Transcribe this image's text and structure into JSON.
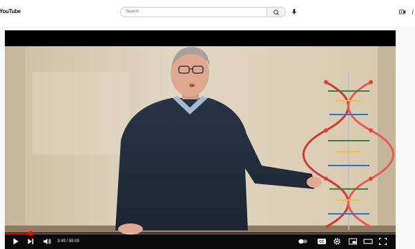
{
  "header": {
    "logo_text": "YouTube",
    "search_placeholder": "Search"
  },
  "player": {
    "current_time": "3:49",
    "separator": " / ",
    "duration": "59:09",
    "progress": 0.0645
  },
  "icons": {
    "search": "search-icon",
    "mic": "microphone-icon",
    "create": "create-video-icon",
    "play": "play-icon",
    "next": "next-icon",
    "volume": "volume-icon",
    "autoplay": "autoplay-toggle-icon",
    "captions": "captions-icon",
    "settings": "gear-icon",
    "miniplayer": "miniplayer-icon",
    "theater": "theater-mode-icon",
    "fullscreen": "fullscreen-icon"
  },
  "colors": {
    "accent": "#ff0000",
    "page_bg": "#f9f9f9",
    "player_bg": "#000000"
  }
}
